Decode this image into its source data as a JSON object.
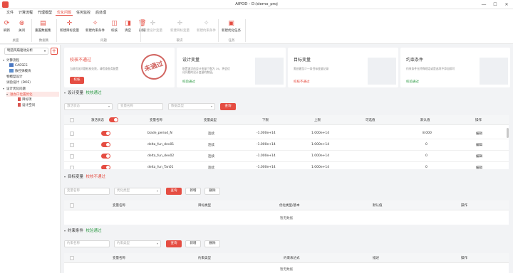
{
  "window": {
    "title": "AIPOD - D:\\demo_proj",
    "min": "—",
    "max": "☐",
    "close": "✕"
  },
  "menu": [
    "文件",
    "计算流程",
    "代理模型",
    "优化问题",
    "任务监控",
    "后处理"
  ],
  "ribbon": {
    "buttons": [
      "刷新",
      "关闭",
      "重置数据集",
      "新建目标变量",
      "新建约束条件",
      "校核",
      "清空",
      "删除",
      "新建设计变量",
      "新建目标变量",
      "新建约束条件",
      "新建优化任务"
    ],
    "groups": [
      "桌面",
      "数据集",
      "问题",
      "取识",
      "任务"
    ]
  },
  "sidebar": {
    "project": "制造风扇驱动分析",
    "tree": [
      "计算流程",
      "CAESES",
      "数控弹模块",
      "物模型设计",
      "试验设计（DOE）",
      "设计优化问题",
      "进办口位置优化",
      "目标项",
      "设计空间"
    ]
  },
  "cards": {
    "verify": {
      "title": "校核不通过",
      "desc": "当前优化问题校核失败，请检查各类配置",
      "button": "校核",
      "stamp": "未通过"
    },
    "design": {
      "title": "设计变量",
      "desc": "配置激活的设计变量个数为 19，将会优化问题的设计变量的数值。",
      "status": "校验通过"
    },
    "objective": {
      "title": "目标变量",
      "desc": "需创建至少一条目标变量记录",
      "status": "校核不通过"
    },
    "constraint": {
      "title": "约束条件",
      "desc": "约束条件无特殊规定或是选项不添加即可",
      "status": "校验通过"
    }
  },
  "design_section": {
    "title": "设计变量",
    "status": "校核通过",
    "filters": [
      "激活状态",
      "变量名称",
      "数据类型"
    ],
    "query": "查询",
    "headers": [
      "激活状态",
      "变量名称",
      "变量类型",
      "下限",
      "上限",
      "可选值",
      "默认值",
      "操作"
    ],
    "rows": [
      {
        "name": "blade_period_N",
        "type": "连续",
        "lower": "-1.000e+14",
        "upper": "1.000e+14",
        "default": "8.000",
        "op": "编辑"
      },
      {
        "name": "delta_fun_dev01",
        "type": "连续",
        "lower": "-1.000e+14",
        "upper": "1.000e+14",
        "default": "0",
        "op": "编辑"
      },
      {
        "name": "delta_fun_dev02",
        "type": "连续",
        "lower": "-1.000e+14",
        "upper": "1.000e+14",
        "default": "0",
        "op": "编辑"
      },
      {
        "name": "delta_fun_Tan01",
        "type": "连续",
        "lower": "-1.000e+14",
        "upper": "1.000e+14",
        "default": "0",
        "op": "编辑"
      }
    ]
  },
  "objective_section": {
    "title": "目标变量",
    "status": "校核不通过",
    "filters": [
      "变量名称",
      "优化类型"
    ],
    "buttons": [
      "查询",
      "新增",
      "删除"
    ],
    "headers": [
      "变量名称",
      "目标类型",
      "优化类型/基本",
      "默认值",
      "操作"
    ],
    "empty": "暂无数据"
  },
  "constraint_section": {
    "title": "约束条件",
    "status": "校验通过",
    "filters": [
      "约束名称",
      "约束类型"
    ],
    "buttons": [
      "查询",
      "新增",
      "删除"
    ],
    "headers": [
      "变量名称",
      "约束类型",
      "约束表达式",
      "描述",
      "操作"
    ],
    "empty": "暂无数据"
  }
}
